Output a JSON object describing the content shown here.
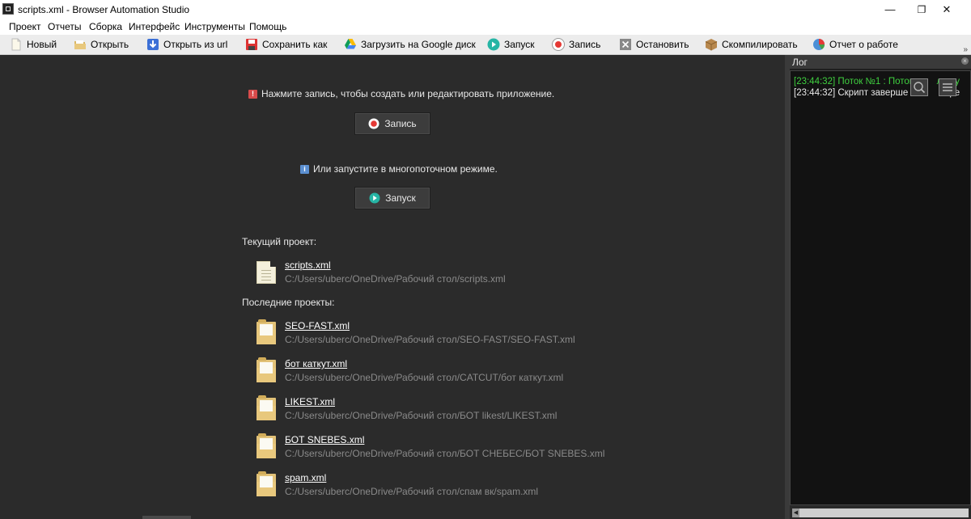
{
  "window": {
    "title": "scripts.xml - Browser Automation Studio"
  },
  "window_controls": {
    "minimize": "—",
    "maximize": "❐",
    "close": "✕"
  },
  "menu": [
    "Проект",
    "Отчеты",
    "Сборка",
    "Интерфейс",
    "Инструменты",
    "Помощь"
  ],
  "toolbar": {
    "items": [
      {
        "label": "Новый",
        "icon": "new-file-icon"
      },
      {
        "label": "Открыть",
        "icon": "open-folder-icon"
      },
      {
        "label": "Открыть из url",
        "icon": "download-arrow-icon"
      },
      {
        "label": "Сохранить как",
        "icon": "save-icon"
      },
      {
        "label": "Загрузить на Google диск",
        "icon": "google-drive-icon"
      },
      {
        "label": "Запуск",
        "icon": "play-icon"
      },
      {
        "label": "Запись",
        "icon": "record-icon"
      },
      {
        "label": "Остановить",
        "icon": "stop-icon"
      },
      {
        "label": "Скомпилировать",
        "icon": "package-icon"
      },
      {
        "label": "Отчет о работе",
        "icon": "pie-chart-icon"
      }
    ],
    "more": "»"
  },
  "main": {
    "record_hint": "Нажмите запись, чтобы создать или редактировать приложение.",
    "record_button": "Запись",
    "run_hint": "Или запустите в многопоточном режиме.",
    "run_button": "Запуск",
    "current_project_label": "Текущий проект:",
    "current_project": {
      "name": "scripts.xml",
      "path": "C:/Users/uberc/OneDrive/Рабочий стол/scripts.xml"
    },
    "recent_projects_label": "Последние проекты:",
    "recent_projects": [
      {
        "name": "SEO-FAST.xml",
        "path": "C:/Users/uberc/OneDrive/Рабочий стол/SEO-FAST/SEO-FAST.xml"
      },
      {
        "name": "бот каткут.xml",
        "path": "C:/Users/uberc/OneDrive/Рабочий стол/CATCUT/бот каткут.xml"
      },
      {
        "name": "LIKEST.xml",
        "path": "C:/Users/uberc/OneDrive/Рабочий стол/БОТ likest/LIKEST.xml"
      },
      {
        "name": "БОТ SNEBES.xml",
        "path": "C:/Users/uberc/OneDrive/Рабочий стол/БОТ СНЕБЕС/БОТ SNEBES.xml"
      },
      {
        "name": "spam.xml",
        "path": "C:/Users/uberc/OneDrive/Рабочий стол/спам вк/spam.xml"
      }
    ]
  },
  "log": {
    "title": "Лог",
    "lines": [
      {
        "text": "[23:44:32] Поток №1 : Поток         лен у",
        "color": "#3fcf3f"
      },
      {
        "text": "[23:44:32] Скрипт заверше                ре",
        "color": "#e8e8e8"
      }
    ]
  },
  "colors": {
    "background": "#2b2b2b",
    "log_green": "#3fcf3f",
    "record_red": "#e53935",
    "play_teal": "#26b5a5"
  }
}
